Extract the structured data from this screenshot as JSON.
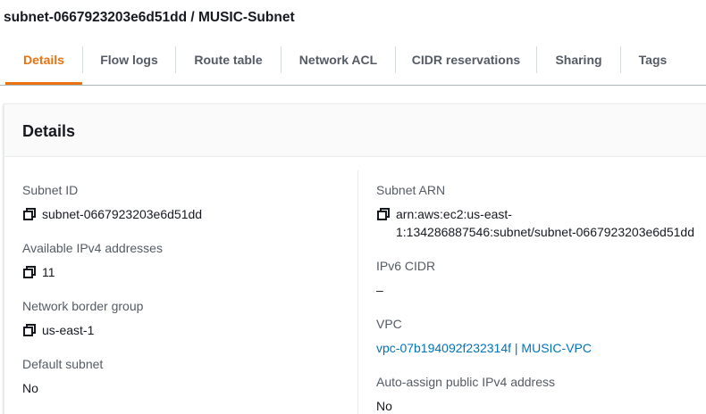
{
  "page": {
    "title": "subnet-0667923203e6d51dd / MUSIC-Subnet"
  },
  "tabs": [
    {
      "label": "Details",
      "active": true
    },
    {
      "label": "Flow logs"
    },
    {
      "label": "Route table"
    },
    {
      "label": "Network ACL"
    },
    {
      "label": "CIDR reservations"
    },
    {
      "label": "Sharing"
    },
    {
      "label": "Tags"
    }
  ],
  "panel": {
    "title": "Details",
    "left": {
      "subnet_id": {
        "label": "Subnet ID",
        "value": "subnet-0667923203e6d51dd",
        "icon": "copy-icon"
      },
      "available_ipv4": {
        "label": "Available IPv4 addresses",
        "value": "11",
        "icon": "copy-icon"
      },
      "network_border_group": {
        "label": "Network border group",
        "value": "us-east-1",
        "icon": "copy-icon"
      },
      "default_subnet": {
        "label": "Default subnet",
        "value": "No"
      }
    },
    "right": {
      "subnet_arn": {
        "label": "Subnet ARN",
        "value": "arn:aws:ec2:us-east-\n1:134286887546:subnet/subnet-0667923203e6d51dd",
        "icon": "copy-icon"
      },
      "ipv6_cidr": {
        "label": "IPv6 CIDR",
        "value": "–"
      },
      "vpc": {
        "label": "VPC",
        "value": "vpc-07b194092f232314f | MUSIC-VPC"
      },
      "auto_assign_ipv4": {
        "label": "Auto-assign public IPv4 address",
        "value": "No"
      }
    }
  },
  "colors": {
    "accent": "#ec7211",
    "link": "#0073bb",
    "text": "#16191f",
    "muted": "#545b64"
  }
}
